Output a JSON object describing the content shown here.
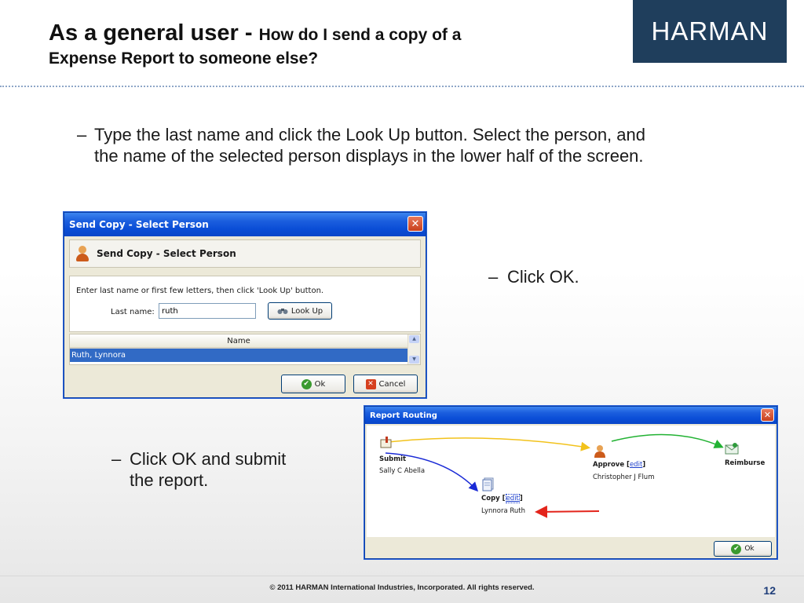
{
  "slide": {
    "title_bold": "As a general user - ",
    "title_rest": "How do I send a copy of a",
    "title_line2": "Expense Report to someone else?",
    "logo_text": "HARMAN",
    "bullet1_line1": "Type the last name and click the Look Up button.  Select the person, and",
    "bullet1_line2": "the name of the selected person displays in the lower half of the screen.",
    "bullet2": "Click OK.",
    "bullet3_line1": "Click OK and submit",
    "bullet3_line2": "the report.",
    "dash": "–",
    "footer": "© 2011 HARMAN International Industries, Incorporated.  All rights reserved.",
    "page_number": "12"
  },
  "select_person_dialog": {
    "window_title": "Send Copy - Select Person",
    "close_glyph": "✕",
    "header": "Send Copy - Select Person",
    "instruction": "Enter last name or first few letters, then click 'Look Up' button.",
    "last_name_label": "Last name:",
    "last_name_value": "ruth",
    "lookup_label": "Look Up",
    "grid_header": "Name",
    "grid_rows": [
      "Ruth, Lynnora"
    ],
    "ok_label": "Ok",
    "cancel_label": "Cancel"
  },
  "routing_dialog": {
    "window_title": "Report Routing",
    "close_glyph": "✕",
    "submit_label": "Submit",
    "submit_person": "Sally C Abella",
    "approve_label": "Approve",
    "approve_edit": "edit",
    "approve_person": "Christopher J Flum",
    "reimburse_label": "Reimburse",
    "copy_label": "Copy",
    "copy_edit": "edit",
    "copy_person": "Lynnora Ruth",
    "ok_label": "Ok",
    "colors": {
      "submit_to_approve": "#f2c21b",
      "submit_to_copy": "#1a2ad6",
      "approve_to_reimburse": "#22b233",
      "pointer_arrow": "#e3241b"
    }
  }
}
